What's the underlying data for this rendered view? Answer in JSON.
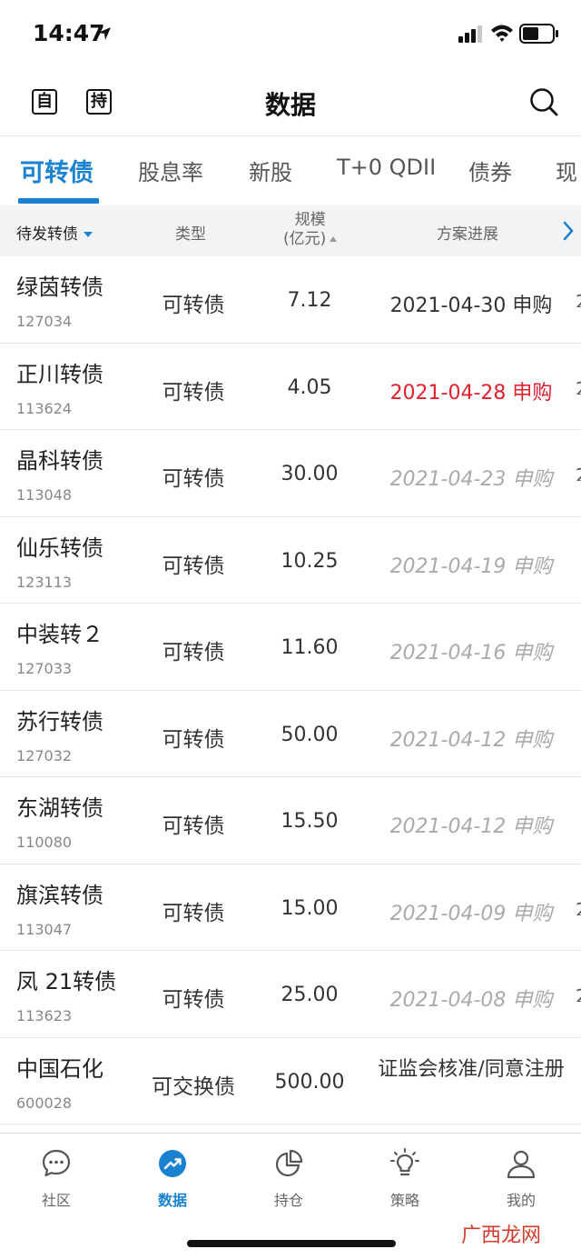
{
  "status": {
    "time": "14:47"
  },
  "header": {
    "btn_self": "自",
    "btn_hold": "持",
    "title": "数据"
  },
  "tabs": [
    {
      "label": "可转债",
      "active": true
    },
    {
      "label": "股息率"
    },
    {
      "label": "新股"
    },
    {
      "label": "T+0 QDII"
    },
    {
      "label": "债券"
    },
    {
      "label": "现"
    }
  ],
  "columns": {
    "name": "待发转债",
    "type": "类型",
    "size_l1": "规模",
    "size_l2": "(亿元)",
    "progress": "方案进展"
  },
  "rows": [
    {
      "name": "绿茵转债",
      "code": "127034",
      "type": "可转债",
      "size": "7.12",
      "progress": "2021-04-30 申购",
      "style": "normal"
    },
    {
      "name": "正川转债",
      "code": "113624",
      "type": "可转债",
      "size": "4.05",
      "progress": "2021-04-28 申购",
      "style": "red"
    },
    {
      "name": "晶科转债",
      "code": "113048",
      "type": "可转债",
      "size": "30.00",
      "progress": "2021-04-23 申购",
      "style": "past"
    },
    {
      "name": "仙乐转债",
      "code": "123113",
      "type": "可转债",
      "size": "10.25",
      "progress": "2021-04-19 申购",
      "style": "past"
    },
    {
      "name": "中装转２",
      "code": "127033",
      "type": "可转债",
      "size": "11.60",
      "progress": "2021-04-16 申购",
      "style": "past"
    },
    {
      "name": "苏行转债",
      "code": "127032",
      "type": "可转债",
      "size": "50.00",
      "progress": "2021-04-12 申购",
      "style": "past"
    },
    {
      "name": "东湖转债",
      "code": "110080",
      "type": "可转债",
      "size": "15.50",
      "progress": "2021-04-12 申购",
      "style": "past"
    },
    {
      "name": "旗滨转债",
      "code": "113047",
      "type": "可转债",
      "size": "15.00",
      "progress": "2021-04-09 申购",
      "style": "past"
    },
    {
      "name": "凤 21转债",
      "code": "113623",
      "type": "可转债",
      "size": "25.00",
      "progress": "2021-04-08 申购",
      "style": "past"
    },
    {
      "name": "中国石化",
      "code": "600028",
      "type": "可交换债",
      "size": "500.00",
      "progress": "证监会核准/同意注册",
      "style": "multi"
    }
  ],
  "bottom_tabs": [
    {
      "label": "社区",
      "icon": "chat-bubble-icon"
    },
    {
      "label": "数据",
      "icon": "trend-up-icon",
      "active": true
    },
    {
      "label": "持仓",
      "icon": "pie-chart-icon"
    },
    {
      "label": "策略",
      "icon": "lightbulb-icon"
    },
    {
      "label": "我的",
      "icon": "person-icon"
    }
  ],
  "watermark": "广西龙网",
  "colors": {
    "accent": "#1a82d0",
    "highlight_red": "#e0202e",
    "past_gray": "#aaaaaa"
  }
}
